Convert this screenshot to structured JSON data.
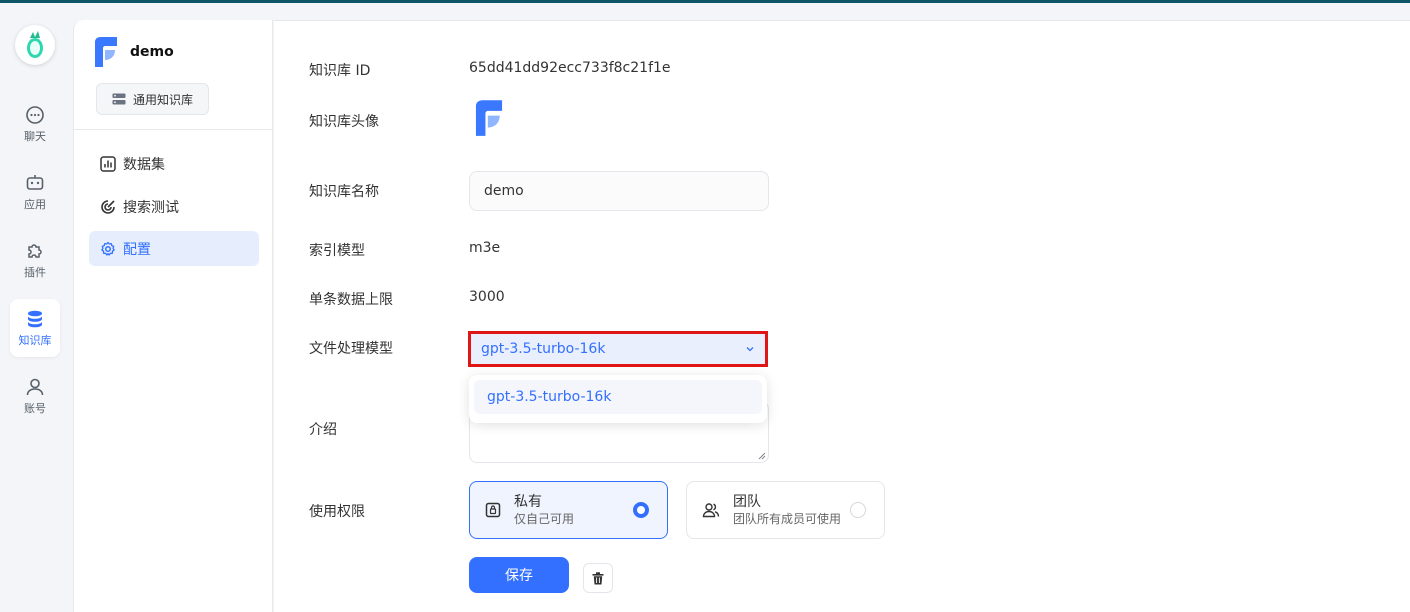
{
  "nav": {
    "items": [
      {
        "label": "聊天",
        "icon": "chat-icon"
      },
      {
        "label": "应用",
        "icon": "robot-icon"
      },
      {
        "label": "插件",
        "icon": "puzzle-icon"
      },
      {
        "label": "知识库",
        "icon": "database-icon"
      },
      {
        "label": "账号",
        "icon": "user-icon"
      }
    ]
  },
  "sidebar": {
    "kb_name": "demo",
    "kb_type": "通用知识库",
    "menu": [
      {
        "label": "数据集",
        "icon": "chart-icon"
      },
      {
        "label": "搜索测试",
        "icon": "target-icon"
      },
      {
        "label": "配置",
        "icon": "gear-icon"
      }
    ]
  },
  "form": {
    "id_label": "知识库 ID",
    "id_value": "65dd41dd92ecc733f8c21f1e",
    "avatar_label": "知识库头像",
    "name_label": "知识库名称",
    "name_value": "demo",
    "index_model_label": "索引模型",
    "index_model_value": "m3e",
    "max_chunk_label": "单条数据上限",
    "max_chunk_value": "3000",
    "file_model_label": "文件处理模型",
    "file_model_value": "gpt-3.5-turbo-16k",
    "file_model_options": [
      "gpt-3.5-turbo-16k"
    ],
    "intro_label": "介绍",
    "permission_label": "使用权限",
    "permissions": [
      {
        "title": "私有",
        "desc": "仅自己可用"
      },
      {
        "title": "团队",
        "desc": "团队所有成员可使用"
      }
    ],
    "save_label": "保存"
  },
  "colors": {
    "primary": "#3370ff",
    "highlight_border": "#e01515",
    "topbar": "#0e5566"
  }
}
